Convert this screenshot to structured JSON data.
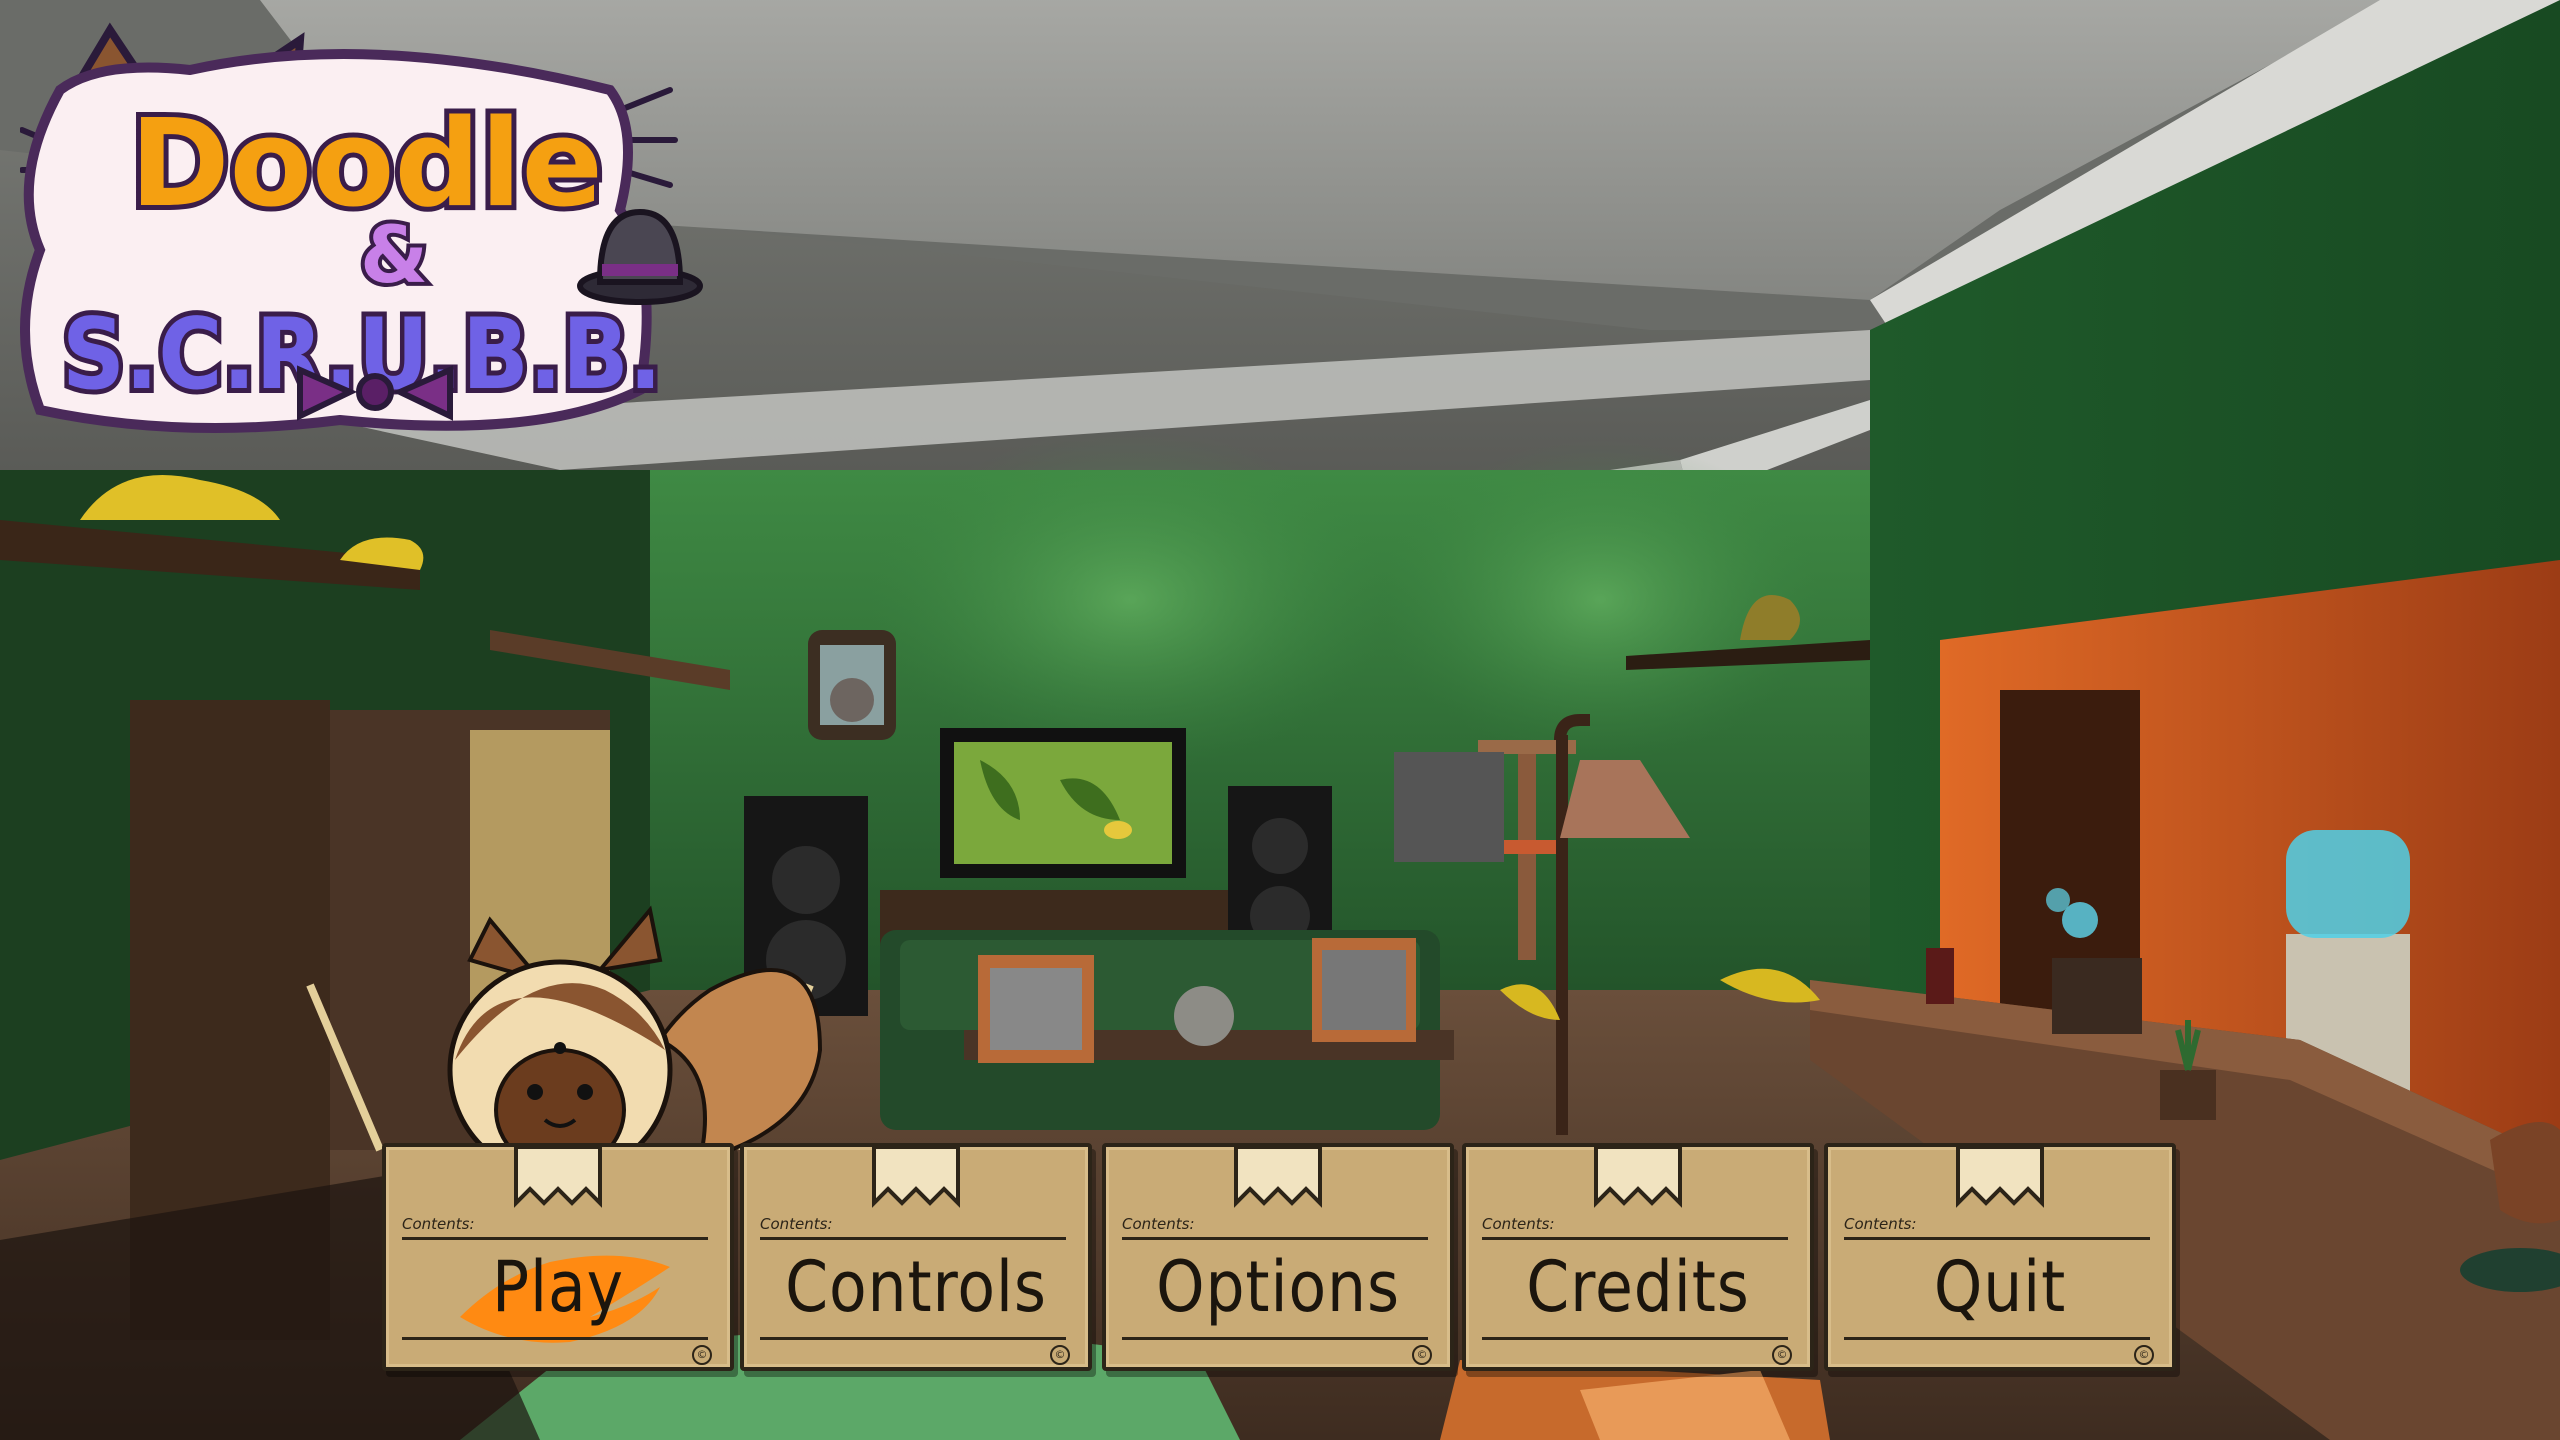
{
  "game": {
    "title_line1": "Doodle",
    "title_ampersand": "&",
    "title_line2": "S.C.R.U.B.B."
  },
  "menu": {
    "contents_label": "Contents:",
    "copyright_symbol": "©",
    "selected_index": 0,
    "items": [
      {
        "label": "Play"
      },
      {
        "label": "Controls"
      },
      {
        "label": "Options"
      },
      {
        "label": "Credits"
      },
      {
        "label": "Quit"
      }
    ]
  },
  "colors": {
    "box_fill": "#c9ab76",
    "box_outline": "#2c2418",
    "highlight_scribble": "#ff8a12",
    "wall_green": "#2f6b34",
    "accent_orange": "#c2511e"
  }
}
